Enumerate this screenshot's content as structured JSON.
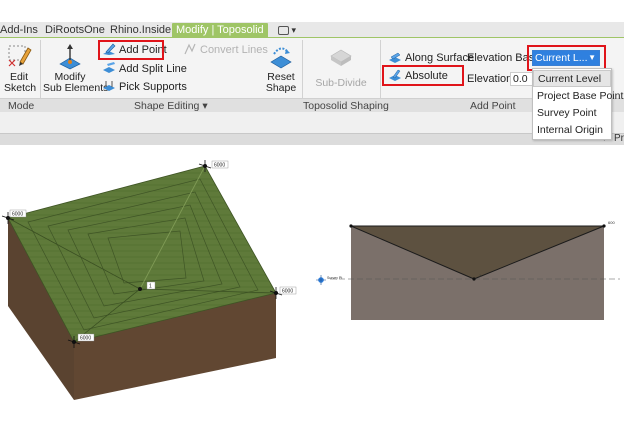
{
  "tabs": [
    {
      "label": "Add-Ins",
      "active": false
    },
    {
      "label": "DiRootsOne",
      "active": false
    },
    {
      "label": "Rhino.Inside",
      "active": false
    },
    {
      "label": "Modify | Toposolid",
      "active": true
    }
  ],
  "mode_panel": {
    "title": "Mode",
    "edit_sketch": [
      "Edit",
      "Sketch"
    ]
  },
  "shape_editing": {
    "title": "Shape Editing",
    "modify_sub_elements": [
      "Modify",
      "Sub Elements"
    ],
    "add_point": "Add Point",
    "add_split_line": "Add Split Line",
    "pick_supports": "Pick Supports",
    "convert_lines": "Convert Lines",
    "reset_shape": [
      "Reset",
      "Shape"
    ]
  },
  "toposolid_shaping": {
    "title": "Toposolid Shaping",
    "sub_divide": "Sub-Divide"
  },
  "add_point_panel": {
    "title": "Add Point",
    "along_surface": "Along Surface",
    "absolute": "Absolute",
    "elevation_base_label": "Elevation Base",
    "elevation_base_value": "Current L...",
    "elevation_label": "Elevation:",
    "elevation_value": "0.0",
    "options": [
      "Current Level",
      "Project Base Point",
      "Survey Point",
      "Internal Origin"
    ],
    "partial_right_text": "Pr"
  },
  "viewport": {
    "labels": {
      "top": "6000",
      "left": "6000",
      "right": "6000",
      "front": "6000",
      "center": "1",
      "section_point": "1",
      "section_edge": "600",
      "base_point": "Survey Pt"
    }
  },
  "colors": {
    "accent_green": "#9fc566",
    "highlight_red": "#e0141a",
    "selection_blue": "#2f80df",
    "terrain_top": "#5f7a3a",
    "terrain_side": "#5e4633",
    "section_fill": "#7b706a",
    "section_top": "#5d5140"
  }
}
